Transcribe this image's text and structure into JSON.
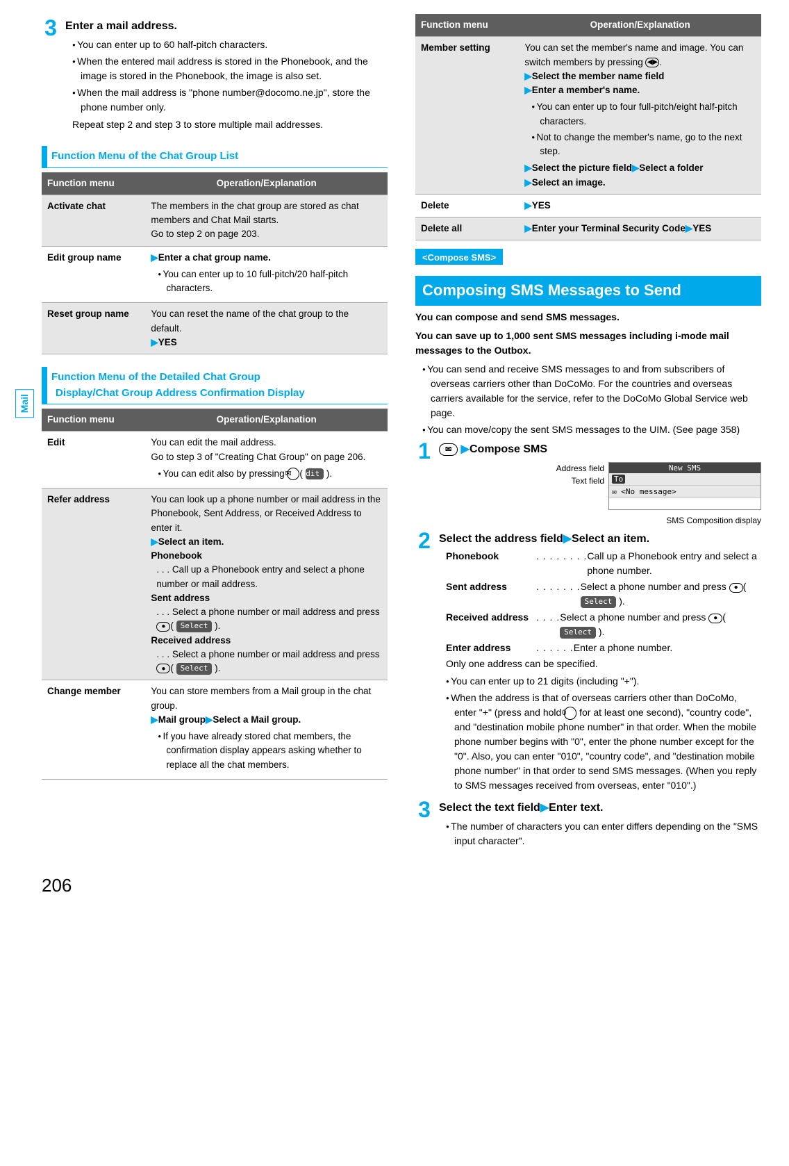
{
  "tab_label": "Mail",
  "left": {
    "step3": {
      "num": "3",
      "title": "Enter a mail address.",
      "bullets": [
        "You can enter up to 60 half-pitch characters.",
        "When the entered mail address is stored in the Phonebook, and the image is stored in the Phonebook, the image is also set.",
        "When the mail address is \"phone number@docomo.ne.jp\", store the phone number only."
      ],
      "repeat": "Repeat step 2 and step 3 to store multiple mail addresses."
    },
    "fm1_title": "Function Menu of the Chat Group List",
    "fm1_head_left": "Function menu",
    "fm1_head_right": "Operation/Explanation",
    "fm1_r1_name": "Activate chat",
    "fm1_r1_text": "The members in the chat group are stored as chat members and Chat Mail starts.\nGo to step 2 on page 203.",
    "fm1_r2_name": "Edit group name",
    "fm1_r2_action": "Enter a chat group name.",
    "fm1_r2_bul": "You can enter up to 10 full-pitch/20 half-pitch characters.",
    "fm1_r3_name": "Reset group name",
    "fm1_r3_text": "You can reset the name of the chat group to the default.",
    "fm1_r3_yes": "YES",
    "fm2_title1": "Function Menu of the Detailed Chat Group",
    "fm2_title2": "Display/Chat Group Address Confirmation Display",
    "fm2_head_left": "Function menu",
    "fm2_head_right": "Operation/Explanation",
    "fm2_r1_name": "Edit",
    "fm2_r1_text": "You can edit the mail address.\nGo to step 3 of \"Creating Chat Group\" on page 206.",
    "fm2_r1_bul": "You can edit also by pressing ",
    "fm2_r1_btn_icon": "✉",
    "fm2_r1_btn_label": "Edit",
    "fm2_r2_name": "Refer address",
    "fm2_r2_text": "You can look up a phone number or mail address in the Phonebook, Sent Address, or Received Address to enter it.",
    "fm2_r2_action": "Select an item.",
    "fm2_r2_pb": "Phonebook",
    "fm2_r2_pb_desc": ". . . Call up a Phonebook entry and select a phone number or mail address.",
    "fm2_r2_sa": "Sent address",
    "fm2_r2_sa_desc": ". . . Select a phone number or mail address and press ",
    "fm2_r2_ra": "Received address",
    "fm2_r2_ra_desc": ". . . Select a phone number or mail address and press ",
    "fm2_r2_select": "Select",
    "fm2_r3_name": "Change member",
    "fm2_r3_text": "You can store members from a Mail group in the chat group.",
    "fm2_r3_action1": "Mail group",
    "fm2_r3_action2": "Select a Mail group.",
    "fm2_r3_bul": "If you have already stored chat members, the confirmation display appears asking whether to replace all the chat members."
  },
  "right": {
    "fm_head_left": "Function menu",
    "fm_head_right": "Operation/Explanation",
    "rm1_name": "Member setting",
    "rm1_text": "You can set the member's name and image. You can switch members by pressing ",
    "rm1_action1": "Select the member name field",
    "rm1_action2": "Enter a member's name.",
    "rm1_bul1": "You can enter up to four full-pitch/eight half-pitch characters.",
    "rm1_bul2": "Not to change the member's name, go to the next step.",
    "rm1_action3": "Select the picture field",
    "rm1_action4": "Select a folder",
    "rm1_action5": "Select an image.",
    "rm2_name": "Delete",
    "rm2_yes": "YES",
    "rm3_name": "Delete all",
    "rm3_action": "Enter your Terminal Security Code",
    "rm3_yes": "YES",
    "section_pre": "<Compose SMS>",
    "section_title": "Composing SMS Messages to Send",
    "intro1": "You can compose and send SMS messages.",
    "intro2": "You can save up to 1,000 sent SMS messages including i-mode mail messages to the Outbox.",
    "para1": "You can send and receive SMS messages to and from subscribers of overseas carriers other than DoCoMo. For the countries and overseas carriers available for the service, refer to the DoCoMo Global Service web page.",
    "para2": "You can move/copy the sent SMS messages to the UIM. (See page 358)",
    "s1_num": "1",
    "s1_icon": "✉",
    "s1_action": "Compose SMS",
    "sms_addr_label": "Address field",
    "sms_text_label": "Text field",
    "sms_new": "New SMS",
    "sms_to": "To",
    "sms_nomsg": "<No message>",
    "sms_cap": "SMS Composition display",
    "s2_num": "2",
    "s2_title1": "Select the address field",
    "s2_title2": "Select an item.",
    "opt_pb": "Phonebook",
    "opt_pb_desc": "Call up a Phonebook entry and select a phone number.",
    "opt_sa": "Sent address",
    "opt_sa_desc": "Select a phone number and press",
    "opt_ra": "Received address",
    "opt_ra_desc": "Select a phone number and press",
    "opt_ea": "Enter address",
    "opt_ea_desc": "Enter a phone number.",
    "opt_select": "Select",
    "only_one": "Only one address can be specified.",
    "s2_bul1": "You can enter up to 21 digits (including \"+\").",
    "s2_bul2a": "When the address is that of overseas carriers other than DoCoMo, enter \"+\" (press and hold ",
    "s2_bul2_key": "0",
    "s2_bul2b": " for at least one second), \"country code\", and \"destination mobile phone number\" in that order. When the mobile phone number begins with \"0\", enter the phone number except for the \"0\". Also, you can enter \"010\", \"country code\", and \"destination mobile phone number\" in that order to send SMS messages. (When you reply to SMS messages received from overseas, enter \"010\".)",
    "s3_num": "3",
    "s3_title1": "Select the text field",
    "s3_title2": "Enter text.",
    "s3_bul": "The number of characters you can enter differs depending on the \"SMS input character\"."
  },
  "page_number": "206"
}
